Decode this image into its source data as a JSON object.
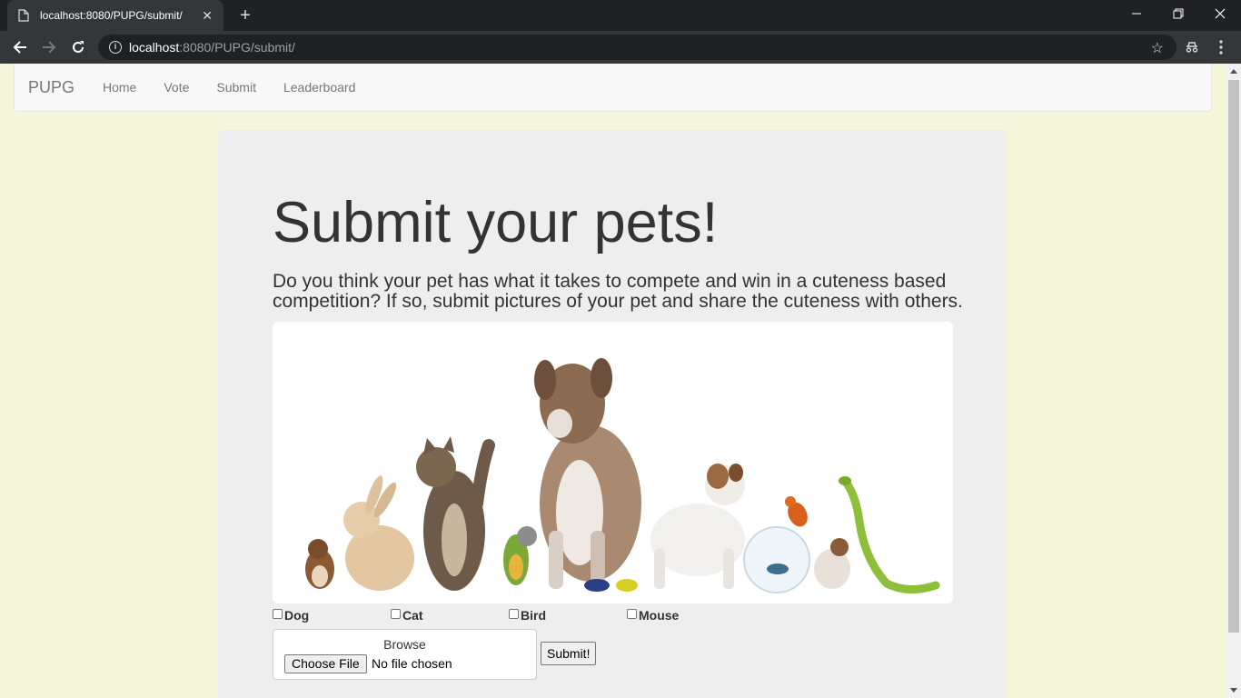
{
  "browser": {
    "tab_title": "localhost:8080/PUPG/submit/",
    "url_host": "localhost",
    "url_path": ":8080/PUPG/submit/"
  },
  "navbar": {
    "brand": "PUPG",
    "links": [
      "Home",
      "Vote",
      "Submit",
      "Leaderboard"
    ]
  },
  "main": {
    "heading": "Submit your pets!",
    "lead": "Do you think your pet has what it takes to compete and win in a cuteness based competition? If so, submit pictures of your pet and share the cuteness with others.",
    "checkboxes": [
      "Dog",
      "Cat",
      "Bird",
      "Mouse"
    ],
    "upload": {
      "label": "Browse",
      "button": "Choose File",
      "status": "No file chosen"
    },
    "submit_label": "Submit!"
  },
  "colors": {
    "page_bg": "#f5f5dc",
    "jumbotron_bg": "#eeeeee",
    "navbar_bg": "#f8f8f8"
  }
}
